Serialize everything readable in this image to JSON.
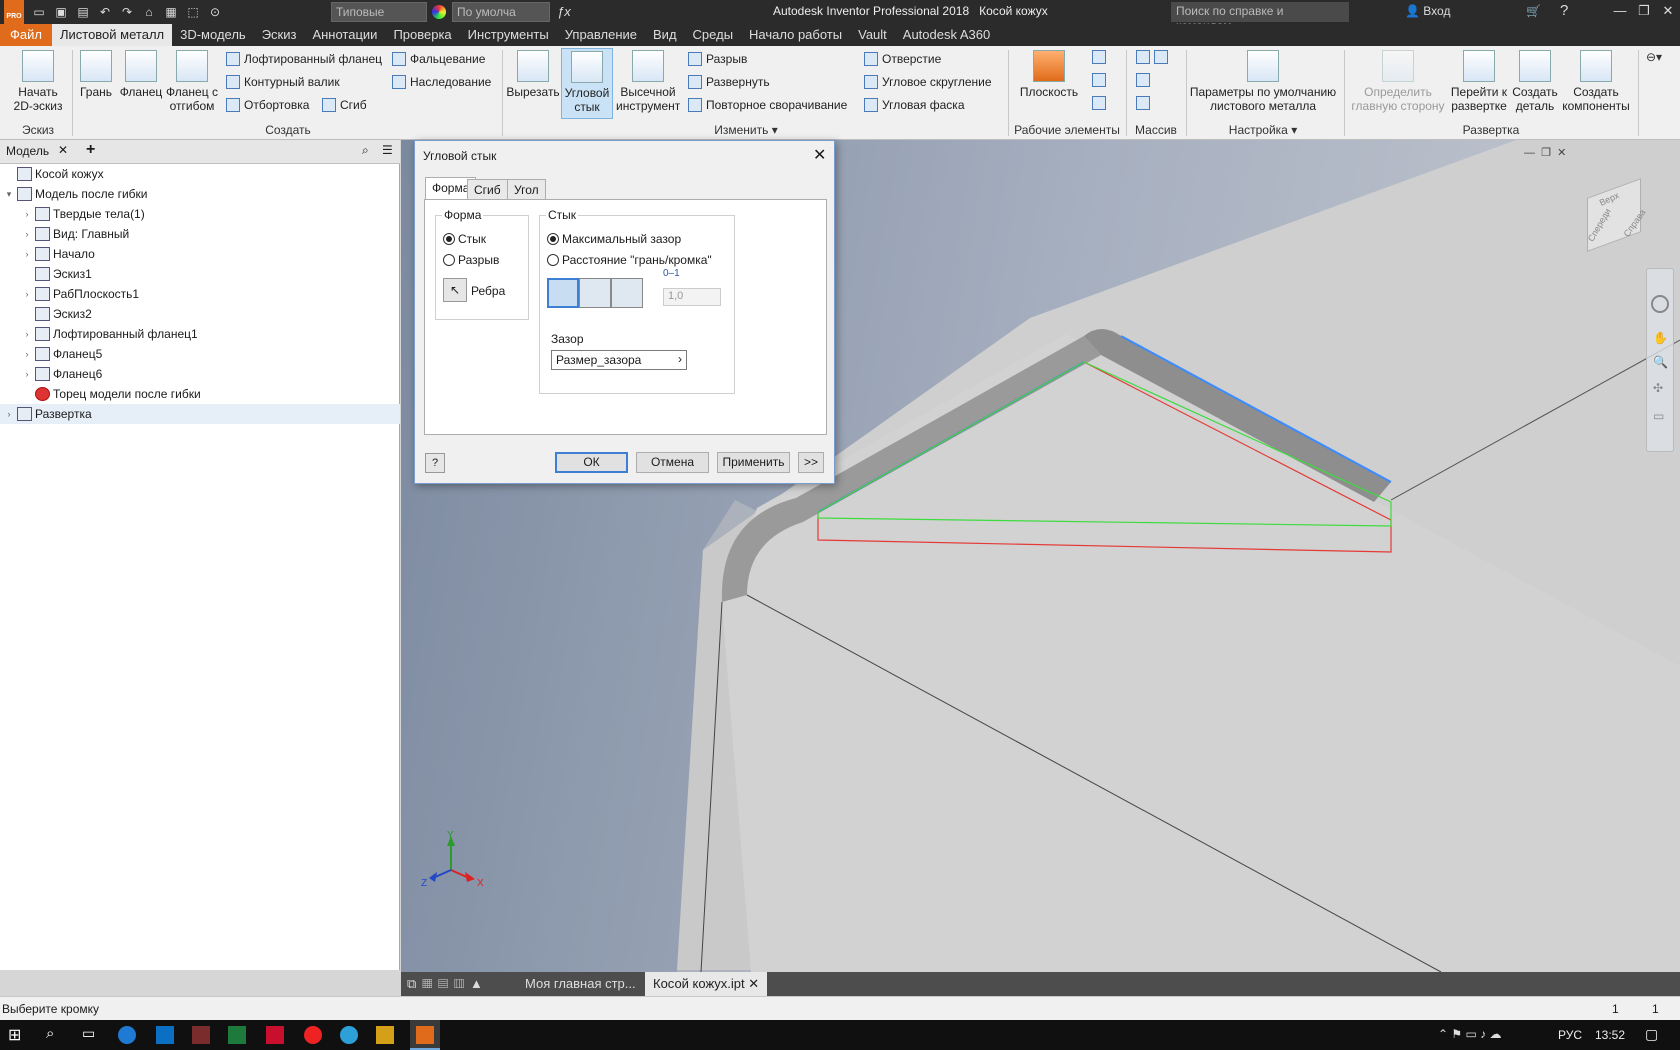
{
  "app": {
    "title": "Autodesk Inventor Professional 2018",
    "document": "Косой кожух",
    "pro_badge": "PRO"
  },
  "titlebar": {
    "appearance_combo": "Типовые",
    "material_combo": "По умолча",
    "help_search_placeholder": "Поиск по справке и командам...",
    "sign_in": "Вход"
  },
  "menu": {
    "file": "Файл",
    "tabs": [
      "Листовой металл",
      "3D-модель",
      "Эскиз",
      "Аннотации",
      "Проверка",
      "Инструменты",
      "Управление",
      "Вид",
      "Среды",
      "Начало работы",
      "Vault",
      "Autodesk A360"
    ]
  },
  "ribbon": {
    "sketch": {
      "start_label": "Начать\n2D-эскиз",
      "group": "Эскиз"
    },
    "create": {
      "group": "Создать",
      "face": "Грань",
      "flange": "Фланец",
      "hem_flange": "Фланец с\nотгибом",
      "lofted_flange": "Лофтированный фланец",
      "contour_roll": "Контурный валик",
      "contour_flange": "Отбортовка",
      "hem": "Фальцевание",
      "inherit": "Наследование",
      "bend": "Сгиб"
    },
    "modify": {
      "group": "Изменить",
      "cut": "Вырезать",
      "corner_seam": "Угловой\nстык",
      "punch_tool": "Высечной\nинструмент",
      "rip": "Разрыв",
      "unfold": "Развернуть",
      "refold": "Повторное сворачивание",
      "hole": "Отверстие",
      "corner_round": "Угловое скругление",
      "corner_chamfer": "Угловая фаска"
    },
    "work_features": {
      "group": "Рабочие элементы",
      "plane": "Плоскость"
    },
    "pattern": {
      "group": "Массив"
    },
    "setup": {
      "group": "Настройка",
      "defaults": "Параметры по умолчанию\nлистового металла"
    },
    "flat_pattern": {
      "group": "Развертка",
      "define_a_side": "Определить\nглавную сторону",
      "go_to_flat": "Перейти к\nразвертке",
      "create_part": "Создать\nдеталь",
      "create_components": "Создать\nкомпоненты"
    }
  },
  "browser": {
    "tab_label": "Модель",
    "items": [
      {
        "label": "Косой кожух",
        "level": 0,
        "expander": ""
      },
      {
        "label": "Модель после гибки",
        "level": 0,
        "expander": "▾"
      },
      {
        "label": "Твердые тела(1)",
        "level": 1,
        "expander": "›"
      },
      {
        "label": "Вид: Главный",
        "level": 1,
        "expander": "›"
      },
      {
        "label": "Начало",
        "level": 1,
        "expander": "›"
      },
      {
        "label": "Эскиз1",
        "level": 1,
        "expander": ""
      },
      {
        "label": "РабПлоскость1",
        "level": 1,
        "expander": "›"
      },
      {
        "label": "Эскиз2",
        "level": 1,
        "expander": ""
      },
      {
        "label": "Лофтированный фланец1",
        "level": 1,
        "expander": "›"
      },
      {
        "label": "Фланец5",
        "level": 1,
        "expander": "›"
      },
      {
        "label": "Фланец6",
        "level": 1,
        "expander": "›"
      },
      {
        "label": "Торец модели после гибки",
        "level": 1,
        "expander": ""
      },
      {
        "label": "Развертка",
        "level": 0,
        "expander": "›"
      }
    ]
  },
  "dialog": {
    "title": "Угловой стык",
    "tabs": [
      "Форма",
      "Сгиб",
      "Угол"
    ],
    "shape_group": "Форма",
    "shape_seam": "Стык",
    "shape_rip": "Разрыв",
    "edges": "Ребра",
    "seam_group": "Стык",
    "max_gap": "Максимальный зазор",
    "face_edge": "Расстояние \"грань/кромка\"",
    "overlap_value": "1,0",
    "gap_label": "Зазор",
    "gap_value": "Размер_зазора",
    "ok": "ОК",
    "cancel": "Отмена",
    "apply": "Применить",
    "more": ">>"
  },
  "triad": {
    "x": "X",
    "y": "Y",
    "z": "Z"
  },
  "viewcube": {
    "top": "Верх",
    "front": "Спереди",
    "right": "Справа"
  },
  "doc_tabs": [
    "Моя главная стр...",
    "Косой кожух.ipt"
  ],
  "status": {
    "prompt": "Выберите кромку",
    "count1": "1",
    "count2": "1"
  },
  "taskbar": {
    "lang": "РУС",
    "time": "13:52"
  },
  "colors": {
    "accent": "#e06b1a",
    "selection": "#3c7fd4",
    "preview_red": "#e53935",
    "preview_green": "#3ddc3d"
  }
}
